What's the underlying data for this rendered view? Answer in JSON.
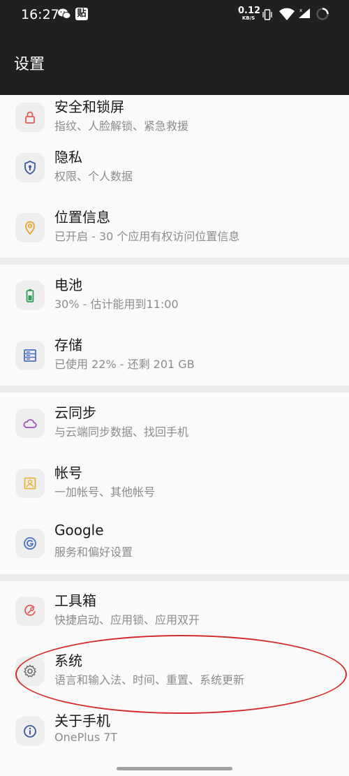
{
  "status_bar": {
    "time": "16:27",
    "notif_badge": "贴",
    "net_speed_value": "0.12",
    "net_speed_unit": "KB/S",
    "signal_badge": "x"
  },
  "app_bar": {
    "title": "设置"
  },
  "colors": {
    "bar_bg": "#202020",
    "list_bg": "#fafafa",
    "highlight": "#d32b2b"
  },
  "items": [
    {
      "title": "安全和锁屏",
      "subtitle": "指纹、人脸解锁、紧急救援",
      "icon": "lock-icon",
      "icon_color": "#e05a5a"
    },
    {
      "title": "隐私",
      "subtitle": "权限、个人数据",
      "icon": "shield-icon",
      "icon_color": "#3d5a9e"
    },
    {
      "title": "位置信息",
      "subtitle": "已开启 - 30 个应用有权访问位置信息",
      "icon": "location-pin-icon",
      "icon_color": "#e8a42c"
    },
    {
      "title": "电池",
      "subtitle": "30% - 估计能用到11:00",
      "icon": "battery-icon",
      "icon_color": "#2e9e58"
    },
    {
      "title": "存储",
      "subtitle": "已使用 22% - 还剩 201 GB",
      "icon": "storage-icon",
      "icon_color": "#4a6fc4"
    },
    {
      "title": "云同步",
      "subtitle": "与云端同步数据、找回手机",
      "icon": "cloud-icon",
      "icon_color": "#a14fbf"
    },
    {
      "title": "帐号",
      "subtitle": "一加帐号、其他帐号",
      "icon": "account-icon",
      "icon_color": "#e8b53c"
    },
    {
      "title": "Google",
      "subtitle": "服务和偏好设置",
      "icon": "google-icon",
      "icon_color": "#4a6fc4"
    },
    {
      "title": "工具箱",
      "subtitle": "快捷启动、应用锁、应用双开",
      "icon": "toolbox-icon",
      "icon_color": "#e05a5a"
    },
    {
      "title": "系统",
      "subtitle": "语言和输入法、时间、重置、系统更新",
      "icon": "gear-icon",
      "icon_color": "#666666"
    },
    {
      "title": "关于手机",
      "subtitle": "OnePlus 7T",
      "icon": "info-icon",
      "icon_color": "#3d5a9e"
    }
  ]
}
